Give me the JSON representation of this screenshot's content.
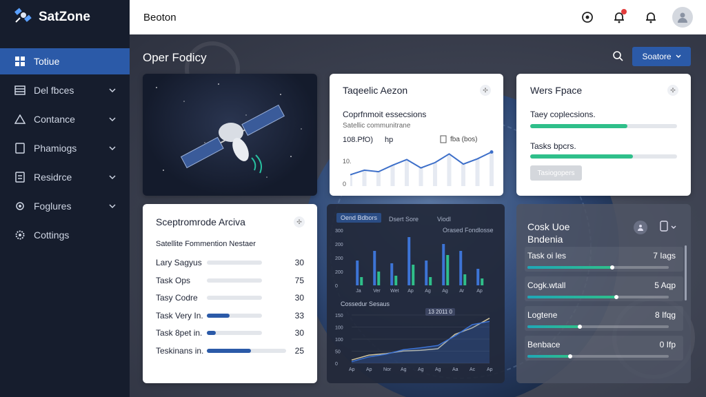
{
  "app": {
    "name": "SatZone"
  },
  "sidebar": {
    "items": [
      {
        "label": "Totiue",
        "icon": "grid-icon",
        "active": true
      },
      {
        "label": "Del fbces",
        "icon": "list-icon"
      },
      {
        "label": "Contance",
        "icon": "warning-icon"
      },
      {
        "label": "Phamiogs",
        "icon": "document-icon"
      },
      {
        "label": "Residrce",
        "icon": "file-icon"
      },
      {
        "label": "Foglures",
        "icon": "settings-icon"
      },
      {
        "label": "Cottings",
        "icon": "gear-icon"
      }
    ]
  },
  "topbar": {
    "title": "Beoton"
  },
  "main": {
    "page_title": "Oper Fodicy",
    "save_label": "Soatore"
  },
  "card_traffic": {
    "title": "Taqeelic Aezon",
    "subtitle": "Coprfnmoit essecsions",
    "caption": "Satellic communitrane",
    "stat_a": "108.PfO)",
    "stat_b": "hp",
    "stat_c": "fba (bos)",
    "y_label": "10.",
    "y_label2": "0"
  },
  "card_work": {
    "title": "Wers Fpace",
    "rows": [
      {
        "label": "Taey coplecsions.",
        "fill": 0.66
      },
      {
        "label": "Tasks bpcrs.",
        "fill": 0.7
      }
    ],
    "button_label": "Tasiogopers"
  },
  "card_archive": {
    "title": "Sceptromrode Arciva",
    "subtitle": "Satellite Fommention Nestaer",
    "rows": [
      {
        "label": "Lary Sagyus",
        "value": "30",
        "fill": 0.0
      },
      {
        "label": "Task Ops",
        "value": "75",
        "fill": 0.0
      },
      {
        "label": "Tasy Codre",
        "value": "30",
        "fill": 0.0
      },
      {
        "label": "Task Very In.",
        "value": "33",
        "fill": 0.41
      },
      {
        "label": "Task 8pet in.",
        "value": "30",
        "fill": 0.16
      },
      {
        "label": "Teskinans in.",
        "value": "25",
        "fill": 0.56
      }
    ]
  },
  "card_charts": {
    "legend_pill": "Oend Bdbors",
    "legend_a": "Dsert Sore",
    "legend_b": "Viodl",
    "legend_c": "Orased Fondlosse",
    "bar_yticks": [
      "300",
      "200",
      "200",
      "200",
      "0"
    ],
    "bar_xticks": [
      "Ja",
      "Ver",
      "Wet",
      "Ap",
      "Ag",
      "Ag",
      "Ar",
      "Ap"
    ],
    "section2_title": "Cossedur Sesaus",
    "tooltip": "13 2011 0",
    "line_yticks": [
      "150",
      "100",
      "100",
      "50",
      "0"
    ],
    "line_xticks": [
      "Ap",
      "Ap",
      "Nor",
      "Ag",
      "Ag",
      "Ag",
      "Aa",
      "Ac",
      "Ap"
    ]
  },
  "card_status": {
    "title_line1": "Cosk Uoe",
    "title_line2": "Bndenia",
    "rows": [
      {
        "label": "Task oi les",
        "value": "7 Iags",
        "fill": 0.6
      },
      {
        "label": "Cogk.wtall",
        "value": "5 Aqp",
        "fill": 0.63
      },
      {
        "label": "Logtene",
        "value": "8 Ifqg",
        "fill": 0.37
      },
      {
        "label": "Benbace",
        "value": "0 Ifp",
        "fill": 0.3
      }
    ]
  },
  "colors": {
    "sidebar_bg": "#161d2d",
    "accent": "#2b5aa8",
    "progress_green": "#2fbf8a",
    "progress_teal": "#1fa7b8",
    "progress_blue": "#2b5aa8"
  },
  "chart_data": [
    {
      "type": "line",
      "title": "",
      "series": [
        {
          "values": [
            30,
            42,
            38,
            55,
            70,
            48,
            62,
            85,
            58,
            72,
            90
          ]
        }
      ],
      "ylim": [
        0,
        100
      ]
    },
    {
      "type": "bar",
      "categories": [
        "Ja",
        "Ver",
        "Wet",
        "Ap",
        "Ag",
        "Ag",
        "Ar",
        "Ap"
      ],
      "series": [
        {
          "values": [
            180,
            250,
            160,
            350,
            180,
            300,
            250,
            120
          ]
        },
        {
          "values": [
            60,
            100,
            70,
            150,
            60,
            220,
            80,
            50
          ]
        }
      ],
      "ylim": [
        0,
        400
      ]
    },
    {
      "type": "line",
      "categories": [
        "Ap",
        "Ap",
        "Nor",
        "Ag",
        "Ag",
        "Ag",
        "Aa",
        "Ac",
        "Ap"
      ],
      "series": [
        {
          "values": [
            10,
            25,
            30,
            38,
            40,
            45,
            90,
            110,
            140
          ]
        },
        {
          "values": [
            5,
            20,
            28,
            42,
            48,
            55,
            85,
            120,
            130
          ]
        }
      ],
      "ylim": [
        0,
        150
      ]
    }
  ]
}
